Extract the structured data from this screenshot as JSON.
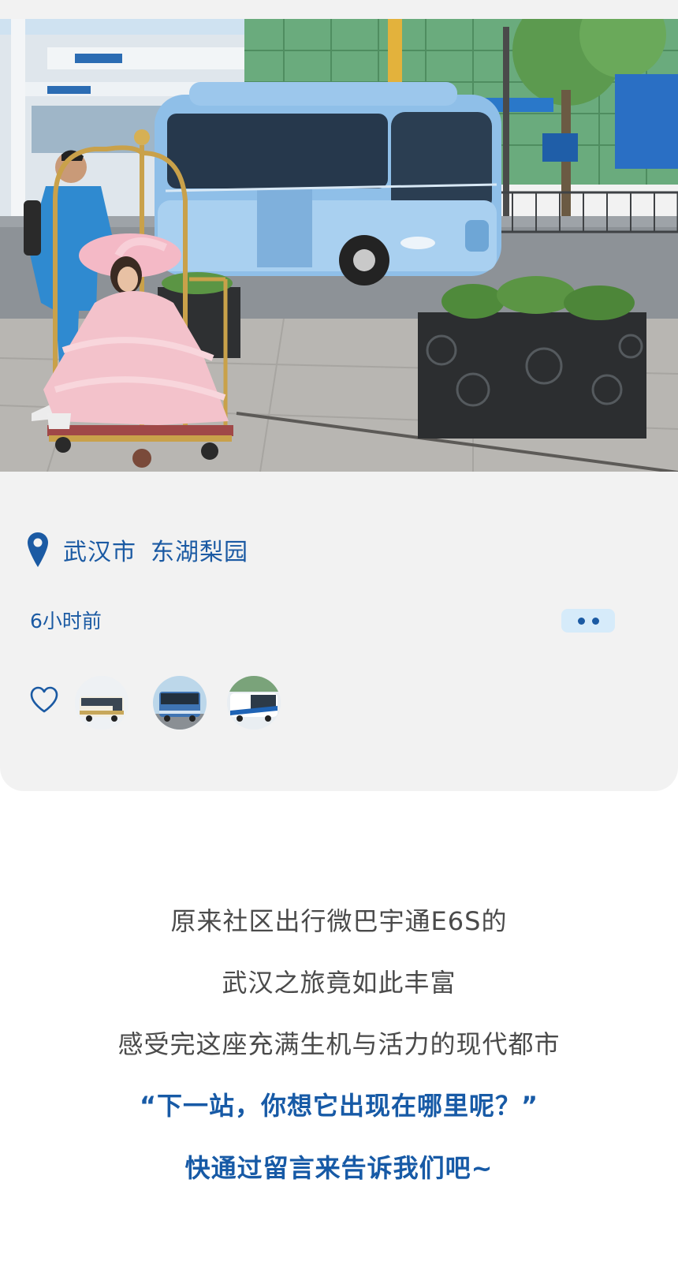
{
  "location": {
    "icon": "location-pin-icon",
    "city": "武汉市",
    "place": "东湖梨园"
  },
  "post": {
    "time_ago": "6小时前",
    "more_icon": "more-dots-icon"
  },
  "reactions": {
    "like_icon": "heart-outline-icon",
    "avatars": [
      "bus-avatar-1",
      "bus-avatar-2",
      "bus-avatar-3"
    ]
  },
  "caption": {
    "line1": "原来社区出行微巴宇通E6S的",
    "line2": "武汉之旅竟如此丰富",
    "line3": "感受完这座充满生机与活力的现代都市",
    "line4": "“下一站，你想它出现在哪里呢？”",
    "line5": "快通过留言来告诉我们吧~"
  },
  "colors": {
    "accent": "#1b5aa3",
    "card_bg": "#f2f2f2",
    "more_bg": "#d6ebfa"
  }
}
